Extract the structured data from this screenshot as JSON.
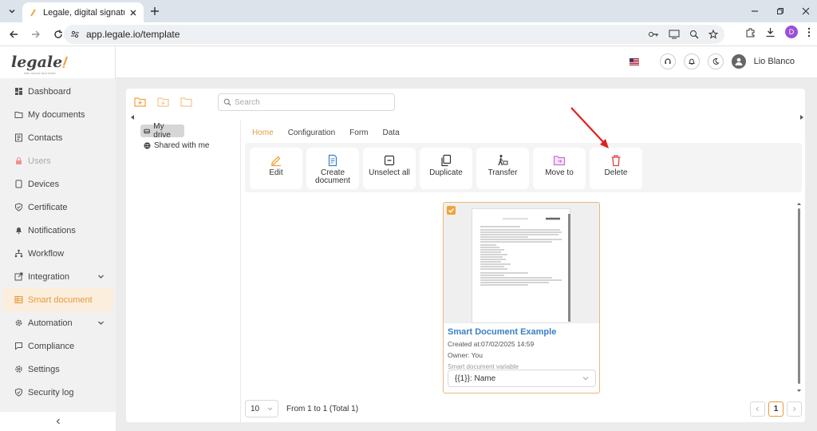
{
  "browser": {
    "tab_title": "Legale, digital signature",
    "url": "app.legale.io/template",
    "profile_initial": "D"
  },
  "app": {
    "logo_text": "legale",
    "logo_tagline": "fast, secure and smart"
  },
  "sidebar": {
    "items": [
      {
        "label": "Dashboard",
        "icon": "dashboard-icon"
      },
      {
        "label": "My documents",
        "icon": "folder-icon"
      },
      {
        "label": "Contacts",
        "icon": "contacts-icon"
      },
      {
        "label": "Users",
        "icon": "lock-icon"
      },
      {
        "label": "Devices",
        "icon": "device-icon"
      },
      {
        "label": "Certificate",
        "icon": "shield-icon"
      },
      {
        "label": "Notifications",
        "icon": "bell-icon"
      },
      {
        "label": "Workflow",
        "icon": "workflow-icon"
      },
      {
        "label": "Integration",
        "icon": "integration-icon"
      },
      {
        "label": "Smart document",
        "icon": "table-icon"
      },
      {
        "label": "Automation",
        "icon": "gear-icon"
      },
      {
        "label": "Compliance",
        "icon": "chat-icon"
      },
      {
        "label": "Settings",
        "icon": "settings-icon"
      },
      {
        "label": "Security log",
        "icon": "security-icon"
      }
    ]
  },
  "header": {
    "user_name": "Lio Blanco"
  },
  "search": {
    "placeholder": "Search"
  },
  "tree": {
    "my_drive": "My drive",
    "shared": "Shared with me"
  },
  "tabs": [
    "Home",
    "Configuration",
    "Form",
    "Data"
  ],
  "actions": {
    "edit": "Edit",
    "create_document": "Create document",
    "unselect_all": "Unselect all",
    "duplicate": "Duplicate",
    "transfer": "Transfer",
    "move_to": "Move to",
    "delete": "Delete"
  },
  "document": {
    "title": "Smart Document Example",
    "created": "Created at:07/02/2025 14:59",
    "owner": "Owner: You",
    "variable_label": "Smart document variable",
    "variable_value": "{{1}}: Name"
  },
  "pager": {
    "page_size": "10",
    "summary": "From 1 to 1 (Total 1)",
    "current_page": "1"
  },
  "colors": {
    "accent": "#e59a3f",
    "link": "#3a80c5",
    "delete": "#e04040",
    "annotation_arrow": "#e02020"
  }
}
